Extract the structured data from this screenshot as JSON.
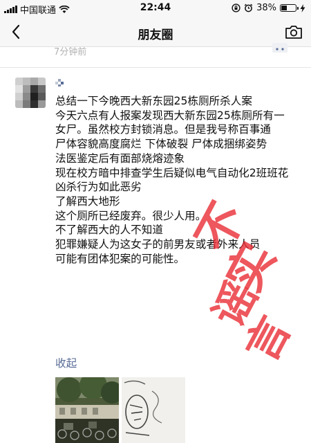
{
  "status": {
    "carrier": "中国联通",
    "time": "22:44",
    "battery": "38%",
    "battery_level": 0.38,
    "icons": [
      "signal-icon",
      "wifi-icon",
      "orientation-lock-icon",
      "alarm-icon",
      "battery-icon",
      "charging-icon"
    ]
  },
  "nav": {
    "title": "朋友圈",
    "back_icon": "chevron-left-icon",
    "camera_icon": "camera-icon"
  },
  "prev_post": {
    "time": "7分钟前"
  },
  "post": {
    "lines": [
      "总结一下今晚西大新东园25栋厕所杀人案",
      "今天六点有人报案发现西大新东园25栋厕所有一女尸。虽然校方封锁消息。但是我号称百事通",
      "尸体容貌高度腐烂 下体破裂 尸体成捆绑姿势",
      "法医鉴定后有面部烧熔迹象",
      "现在校方暗中排查学生后疑似电气自动化2班班花",
      "凶杀行为如此恶劣",
      "了解西大地形",
      "这个厕所已经废弃。很少人用。",
      "不了解西大的人不知道",
      "犯罪嫌疑人为这女子的前男友或者外来人员",
      "可能有团体犯案的可能性。"
    ],
    "collapse_label": "收起"
  },
  "stamp": {
    "text": "不实谣言",
    "color": "#e82830"
  },
  "colors": {
    "link": "#576b95",
    "bar": "#f7f7f7",
    "stamp": "#e82830"
  }
}
